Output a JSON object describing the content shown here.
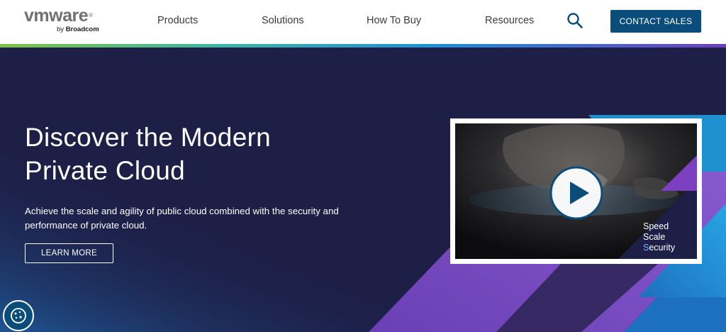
{
  "header": {
    "logo_wordmark": "vmware",
    "logo_sub_prefix": "by",
    "logo_sub_brand": "Broadcom",
    "nav": [
      {
        "label": "Products"
      },
      {
        "label": "Solutions"
      },
      {
        "label": "How To Buy"
      },
      {
        "label": "Resources"
      }
    ],
    "search_icon": "search-icon",
    "contact_label": "CONTACT SALES"
  },
  "hero": {
    "title_line1": "Discover the Modern",
    "title_line2": "Private Cloud",
    "description": "Achieve the scale and agility of public cloud combined with the security and performance of private cloud.",
    "cta_label": "LEARN MORE"
  },
  "video": {
    "line1": "Speed",
    "line2": "Scale",
    "line3_first": "S",
    "line3_rest": "ecurity",
    "play_icon": "play-icon"
  },
  "cookie": {
    "icon": "cookie-icon"
  },
  "colors": {
    "brand": "#0a4d7a",
    "hero_bg": "#1d1f47",
    "accent_purple": "#7b3fbf",
    "accent_blue": "#1d8fd6"
  }
}
